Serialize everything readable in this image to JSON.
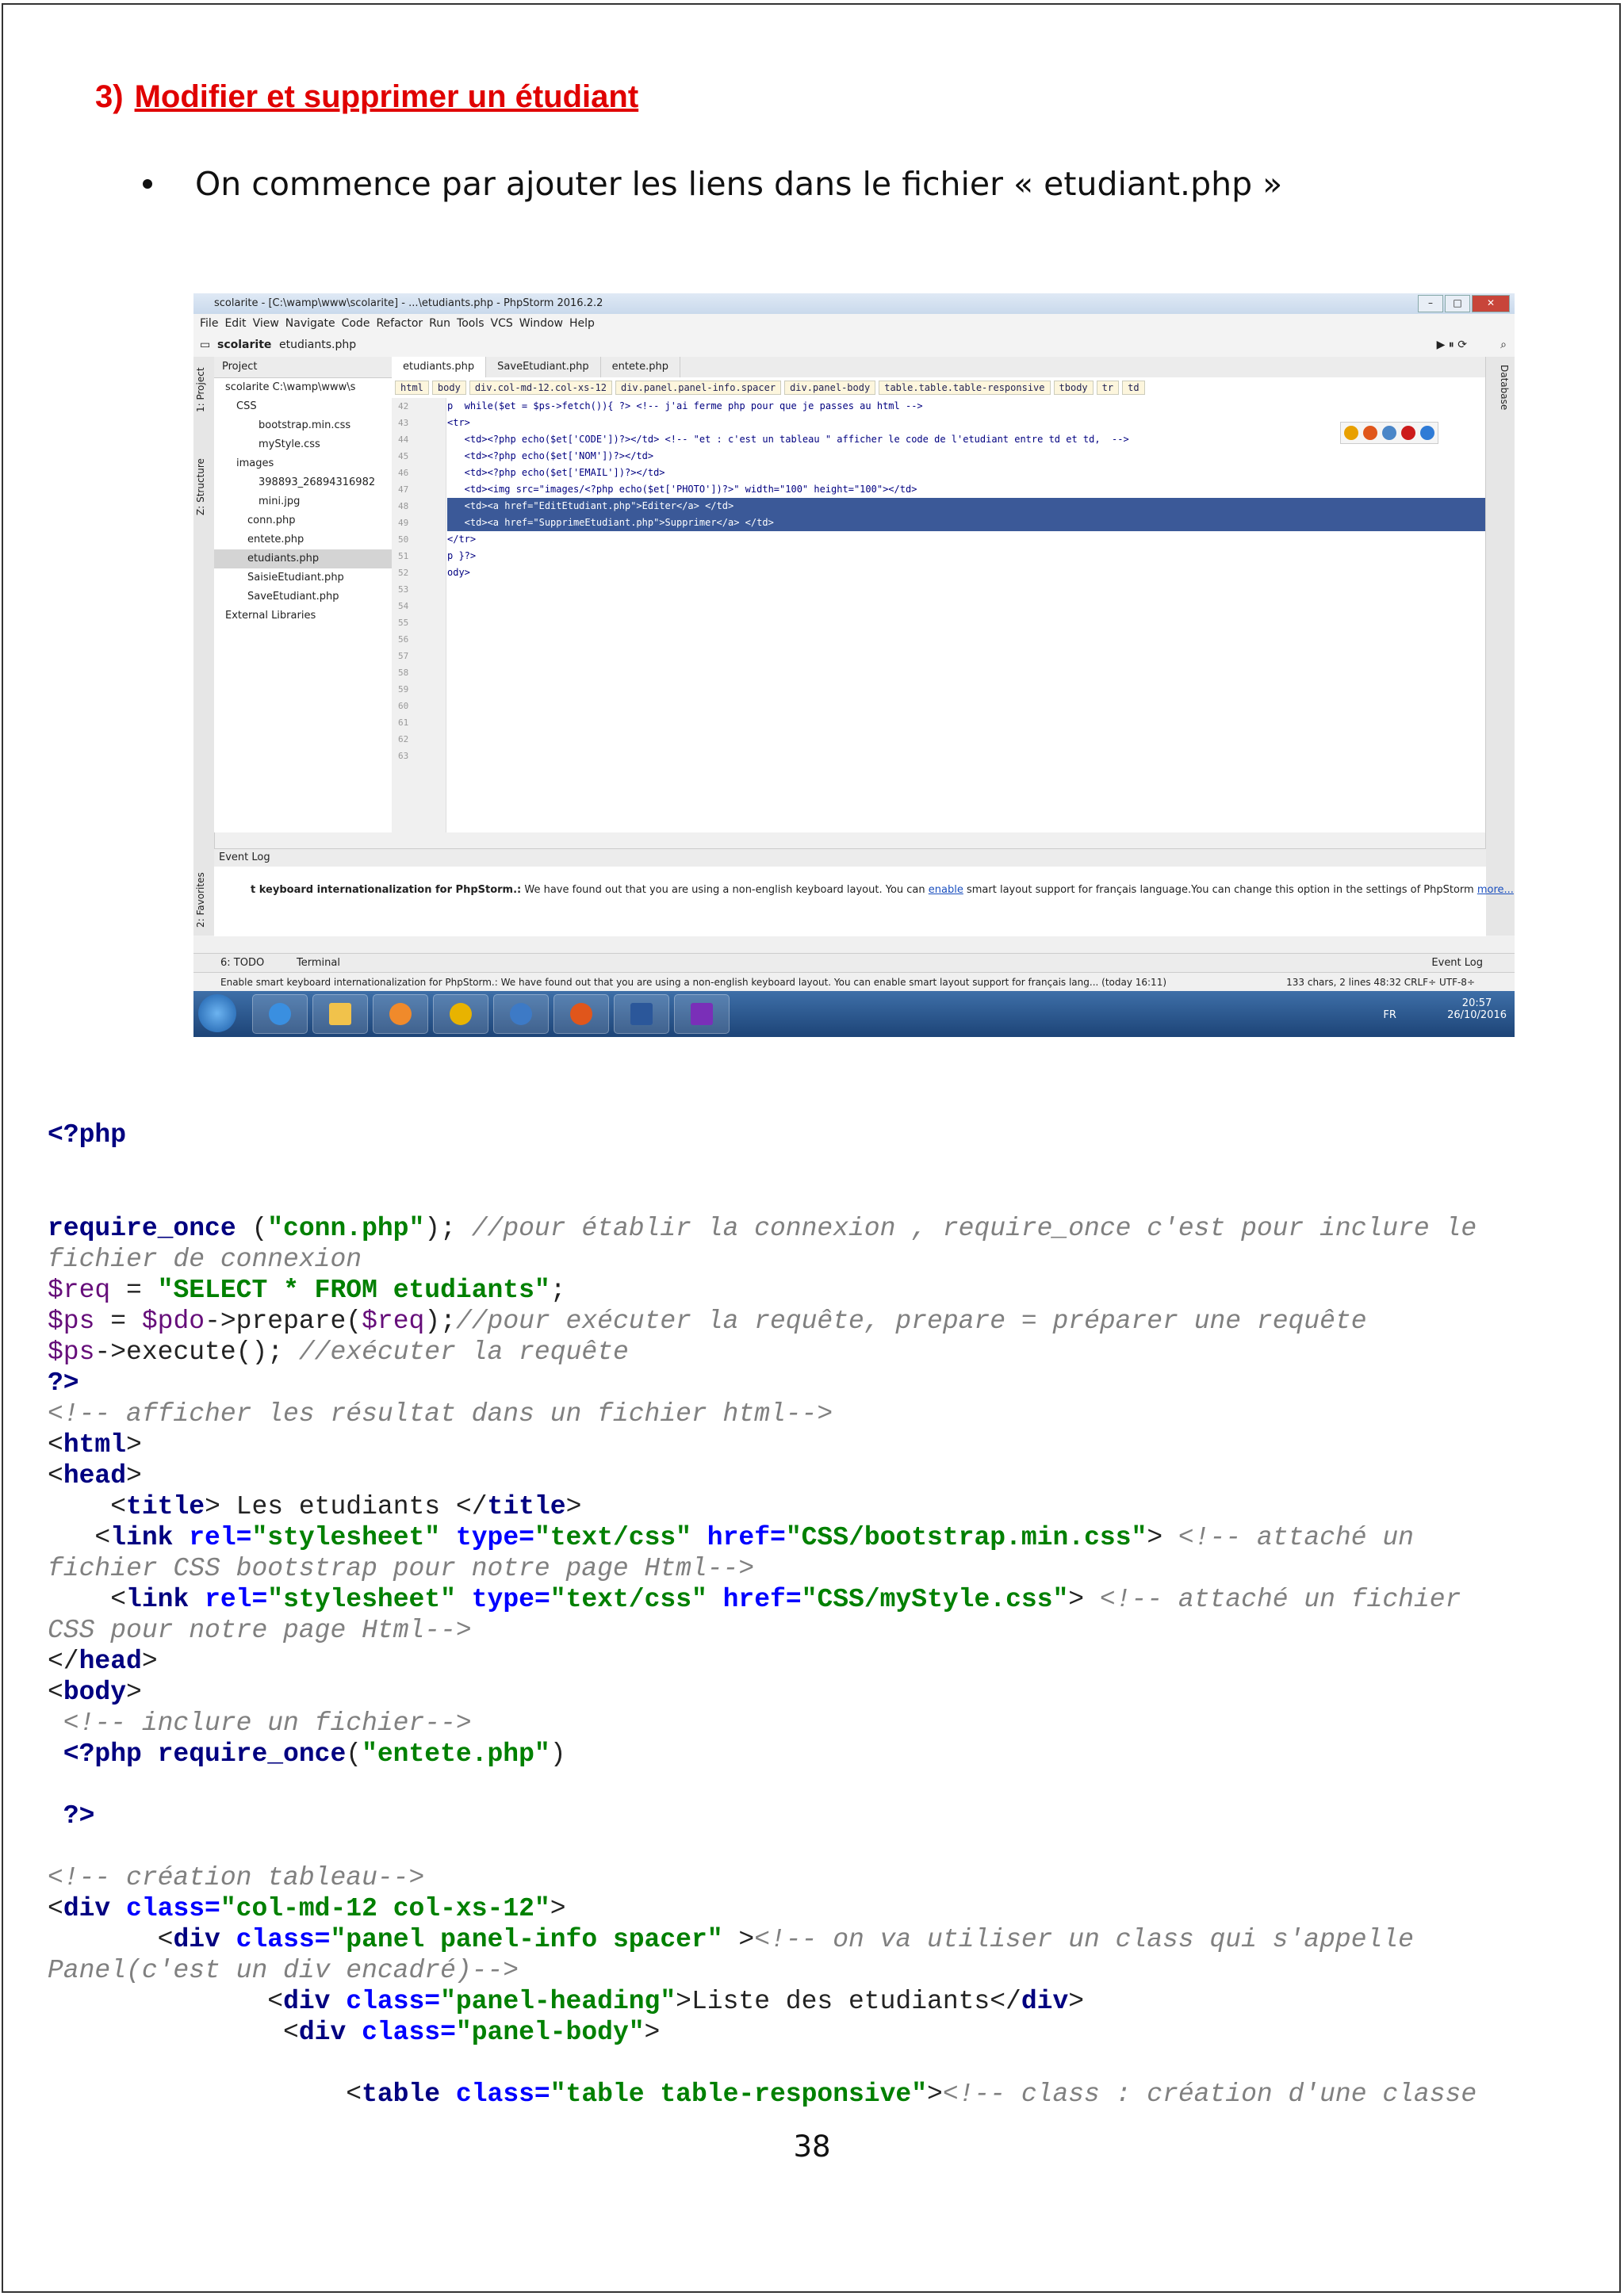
{
  "section": {
    "number": "3)",
    "title": "Modifier et supprimer un étudiant"
  },
  "bullet": "On commence par ajouter les liens dans le fichier « etudiant.php »",
  "screenshot": {
    "window_title": "scolarite - [C:\\wamp\\www\\scolarite] - ...\\etudiants.php - PhpStorm 2016.2.2",
    "menu": [
      "File",
      "Edit",
      "View",
      "Navigate",
      "Code",
      "Refactor",
      "Run",
      "Tools",
      "VCS",
      "Window",
      "Help"
    ],
    "nav_path": [
      "scolarite",
      "etudiants.php"
    ],
    "project_header": "Project",
    "tree": [
      {
        "label": "scolarite  C:\\wamp\\www\\s",
        "indent": 1
      },
      {
        "label": "CSS",
        "indent": 2
      },
      {
        "label": "bootstrap.min.css",
        "indent": 4
      },
      {
        "label": "myStyle.css",
        "indent": 4
      },
      {
        "label": "images",
        "indent": 2
      },
      {
        "label": "398893_26894316982",
        "indent": 4
      },
      {
        "label": "mini.jpg",
        "indent": 4
      },
      {
        "label": "conn.php",
        "indent": 3
      },
      {
        "label": "entete.php",
        "indent": 3
      },
      {
        "label": "etudiants.php",
        "indent": 3,
        "selected": true
      },
      {
        "label": "SaisieEtudiant.php",
        "indent": 3
      },
      {
        "label": "SaveEtudiant.php",
        "indent": 3
      },
      {
        "label": "External Libraries",
        "indent": 1
      }
    ],
    "tabs": [
      "etudiants.php",
      "SaveEtudiant.php",
      "entete.php"
    ],
    "breadcrumb": [
      "html",
      "body",
      "div.col-md-12.col-xs-12",
      "div.panel.panel-info.spacer",
      "div.panel-body",
      "table.table.table-responsive",
      "tbody",
      "tr",
      "td"
    ],
    "line_numbers": [
      "42",
      "43",
      "44",
      "45",
      "46",
      "47",
      "48",
      "49",
      "50",
      "51",
      "52",
      "53",
      "54",
      "55",
      "56",
      "57",
      "58",
      "59",
      "60",
      "61",
      "62",
      "63"
    ],
    "code_lines": [
      {
        "text": "p  while($et = $ps->fetch()){ ?> <!-- j'ai ferme php pour que je passes au html -->",
        "hl": false
      },
      {
        "text": "<tr>",
        "hl": false
      },
      {
        "text": "   <td><?php echo($et['CODE'])?></td> <!-- \"et : c'est un tableau \" afficher le code de l'etudiant entre td et td,  -->",
        "hl": false
      },
      {
        "text": "   <td><?php echo($et['NOM'])?></td>",
        "hl": false
      },
      {
        "text": "   <td><?php echo($et['EMAIL'])?></td>",
        "hl": false
      },
      {
        "text": "   <td><img src=\"images/<?php echo($et['PHOTO'])?>\" width=\"100\" height=\"100\"></td>",
        "hl": false
      },
      {
        "text": "   <td><a href=\"EditEtudiant.php\">Editer</a> </td>",
        "hl": true
      },
      {
        "text": "   <td><a href=\"SupprimeEtudiant.php\">Supprimer</a> </td>",
        "hl": true
      },
      {
        "text": "</tr>",
        "hl": false
      },
      {
        "text": "p }?>",
        "hl": false
      },
      {
        "text": "ody>",
        "hl": false
      }
    ],
    "right_strip": "Database",
    "left_strip": [
      "1: Project",
      "Z: Structure",
      "2: Favorites"
    ],
    "event_log_title": "Event Log",
    "event_log_bold": "t keyboard internationalization for PhpStorm.:",
    "event_log_text": " We have found out that you are using a non-english keyboard layout. You can ",
    "event_log_link": "enable",
    "event_log_text2": " smart layout support for français language.You can change this option in the settings of PhpStorm ",
    "event_log_more": "more...",
    "bottom_tabs": [
      "6: TODO",
      "Terminal",
      "Event Log"
    ],
    "status_text": "Enable smart keyboard internationalization for PhpStorm.: We have found out that you are using a non-english keyboard layout. You can enable smart layout support for français lang... (today 16:11)",
    "status_right": "133 chars, 2 lines    48:32   CRLF÷  UTF-8÷",
    "tray_lang": "FR",
    "tray_time": "20:57",
    "tray_date": "26/10/2016"
  },
  "code": {
    "l1": "<?php",
    "l2a": "require_once",
    "l2b": " (",
    "l2c": "\"conn.php\"",
    "l2d": "); ",
    "l2e": "//pour établir la connexion , require_once c'est pour inclure le",
    "l3": "fichier de connexion",
    "l4a": "$req",
    "l4b": " = ",
    "l4c": "\"SELECT * FROM etudiants\"",
    "l4d": ";",
    "l5a": "$ps",
    "l5b": " = ",
    "l5c": "$pdo",
    "l5d": "->prepare(",
    "l5e": "$req",
    "l5f": ");",
    "l5g": "//pour exécuter la requête, prepare = préparer une requête",
    "l6a": "$ps",
    "l6b": "->execute(); ",
    "l6c": "//exécuter la requête",
    "l7": "?>",
    "l8": "<!-- afficher les résultat dans un fichier html-->",
    "l9a": "<",
    "l9b": "html",
    "l9c": ">",
    "l10b": "head",
    "l11a": "    <",
    "l11b": "title",
    "l11c": "> Les etudiants </",
    "l11d": "title",
    "l11e": ">",
    "l12a": "   <",
    "l12b": "link ",
    "l12c": "rel=",
    "l12d": "\"stylesheet\" ",
    "l12e": "type=",
    "l12f": "\"text/css\" ",
    "l12g": "href=",
    "l12h": "\"CSS/bootstrap.min.css\"",
    "l12i": "> ",
    "l12j": "<!-- attaché un",
    "l13": "fichier CSS bootstrap pour notre page Html-->",
    "l14a": "    <",
    "l14h": "\"CSS/myStyle.css\"",
    "l14j": "<!-- attaché un fichier",
    "l15": "CSS pour notre page Html-->",
    "l16a": "</",
    "l16b": "head",
    "l17b": "body",
    "l18": " <!-- inclure un fichier-->",
    "l19a": " <?php ",
    "l19b": "require_once",
    "l19c": "(",
    "l19d": "\"entete.php\"",
    "l19e": ")",
    "l20": " ?>",
    "l21": "<!-- création tableau-->",
    "l22b": "div ",
    "l22c": "class=",
    "l22d": "\"col-md-12 col-xs-12\"",
    "l23a": "       <",
    "l23d": "\"panel panel-info spacer\" ",
    "l23e": "<!-- on va utiliser un class qui s'appelle",
    "l24": "Panel(c'est un div encadré)-->",
    "l25a": "              <",
    "l25d": "\"panel-heading\"",
    "l25e": ">Liste des etudiants</",
    "l25f": "div",
    "l26a": "               <",
    "l26d": "\"panel-body\"",
    "l27a": "                   <",
    "l27b": "table ",
    "l27d": "\"table table-responsive\"",
    "l27e": "<!-- class : création d'une classe"
  },
  "page_number": "38"
}
